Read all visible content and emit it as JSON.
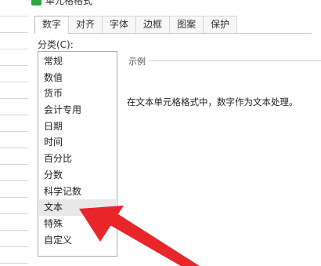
{
  "dialog": {
    "title": "单元格格式",
    "tabs": [
      "数字",
      "对齐",
      "字体",
      "边框",
      "图案",
      "保护"
    ],
    "active_tab": 0,
    "category_label": "分类(C):",
    "categories": [
      "常规",
      "数值",
      "货币",
      "会计专用",
      "日期",
      "时间",
      "百分比",
      "分数",
      "科学记数",
      "文本",
      "特殊",
      "自定义"
    ],
    "selected_category": "文本",
    "sample_label": "示例",
    "description": "在文本单元格格式中，数字作为文本处理。"
  },
  "colors": {
    "title_icon": "#2aa745",
    "annotation_arrow": "#e8262a",
    "selected_row": "#e8e8e8"
  }
}
